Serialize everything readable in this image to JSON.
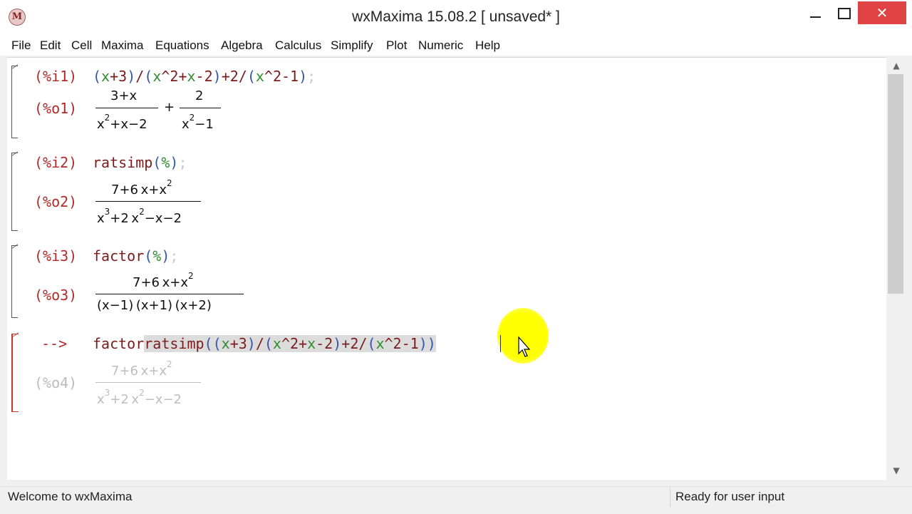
{
  "window": {
    "title": "wxMaxima 15.08.2 [ unsaved* ]",
    "app_icon_letter": "M"
  },
  "menu": [
    "File",
    "Edit",
    "Cell",
    "Maxima",
    "Equations",
    "Algebra",
    "Calculus",
    "Simplify",
    "Plot",
    "Numeric",
    "Help"
  ],
  "cells": {
    "c1": {
      "in_label": "(%i1)",
      "in_parts": [
        "(",
        "x",
        "+3",
        ")",
        "/",
        "(",
        "x",
        "^2+",
        "x",
        "-2",
        ")",
        "+2",
        "/",
        "(",
        "x",
        "^2-1",
        ")",
        ";"
      ],
      "out_label": "(%o1)",
      "out_frac1_num": "3+x",
      "out_frac1_den_a": "x",
      "out_frac1_den_sup": "2",
      "out_frac1_den_b": "+x−2",
      "out_plus": "+",
      "out_frac2_num": "2",
      "out_frac2_den_a": "x",
      "out_frac2_den_sup": "2",
      "out_frac2_den_b": "−1"
    },
    "c2": {
      "in_label": "(%i2)",
      "in_func": "ratsimp",
      "in_open": "(",
      "in_arg": "%",
      "in_close": ")",
      "in_semi": ";",
      "out_label": "(%o2)",
      "num_a": "7+6 x+x",
      "num_sup": "2",
      "den_a": "x",
      "den_sup1": "3",
      "den_b": "+2 x",
      "den_sup2": "2",
      "den_c": "−x−2"
    },
    "c3": {
      "in_label": "(%i3)",
      "in_func": "factor",
      "in_open": "(",
      "in_arg": "%",
      "in_close": ")",
      "in_semi": ";",
      "out_label": "(%o3)",
      "num_a": "7+6 x+x",
      "num_sup": "2",
      "den": "(x−1) (x+1) (x+2)"
    },
    "c4": {
      "prompt": "-->",
      "in_func": "factor",
      "in_func2": "ratsimp",
      "in_tail_parts": [
        "(",
        "(",
        "x",
        "+3",
        ")",
        "/",
        "(",
        "x",
        "^2+",
        "x",
        "-2",
        ")",
        "+2",
        "/",
        "(",
        "x",
        "^2-1",
        ")",
        ")"
      ],
      "out_label": "(%o4)",
      "num_a": "7+6 x+x",
      "num_sup": "2",
      "den_a": "x",
      "den_sup1": "3",
      "den_b": "+2 x",
      "den_sup2": "2",
      "den_c": "−x−2"
    }
  },
  "status": {
    "left": "Welcome to wxMaxima",
    "right": "Ready for user input"
  },
  "colors": {
    "label": "#b02a2a",
    "paren": "#3355aa",
    "variable": "#2e8b2e",
    "close_button": "#e04343",
    "cursor_highlight": "#ffff00"
  }
}
